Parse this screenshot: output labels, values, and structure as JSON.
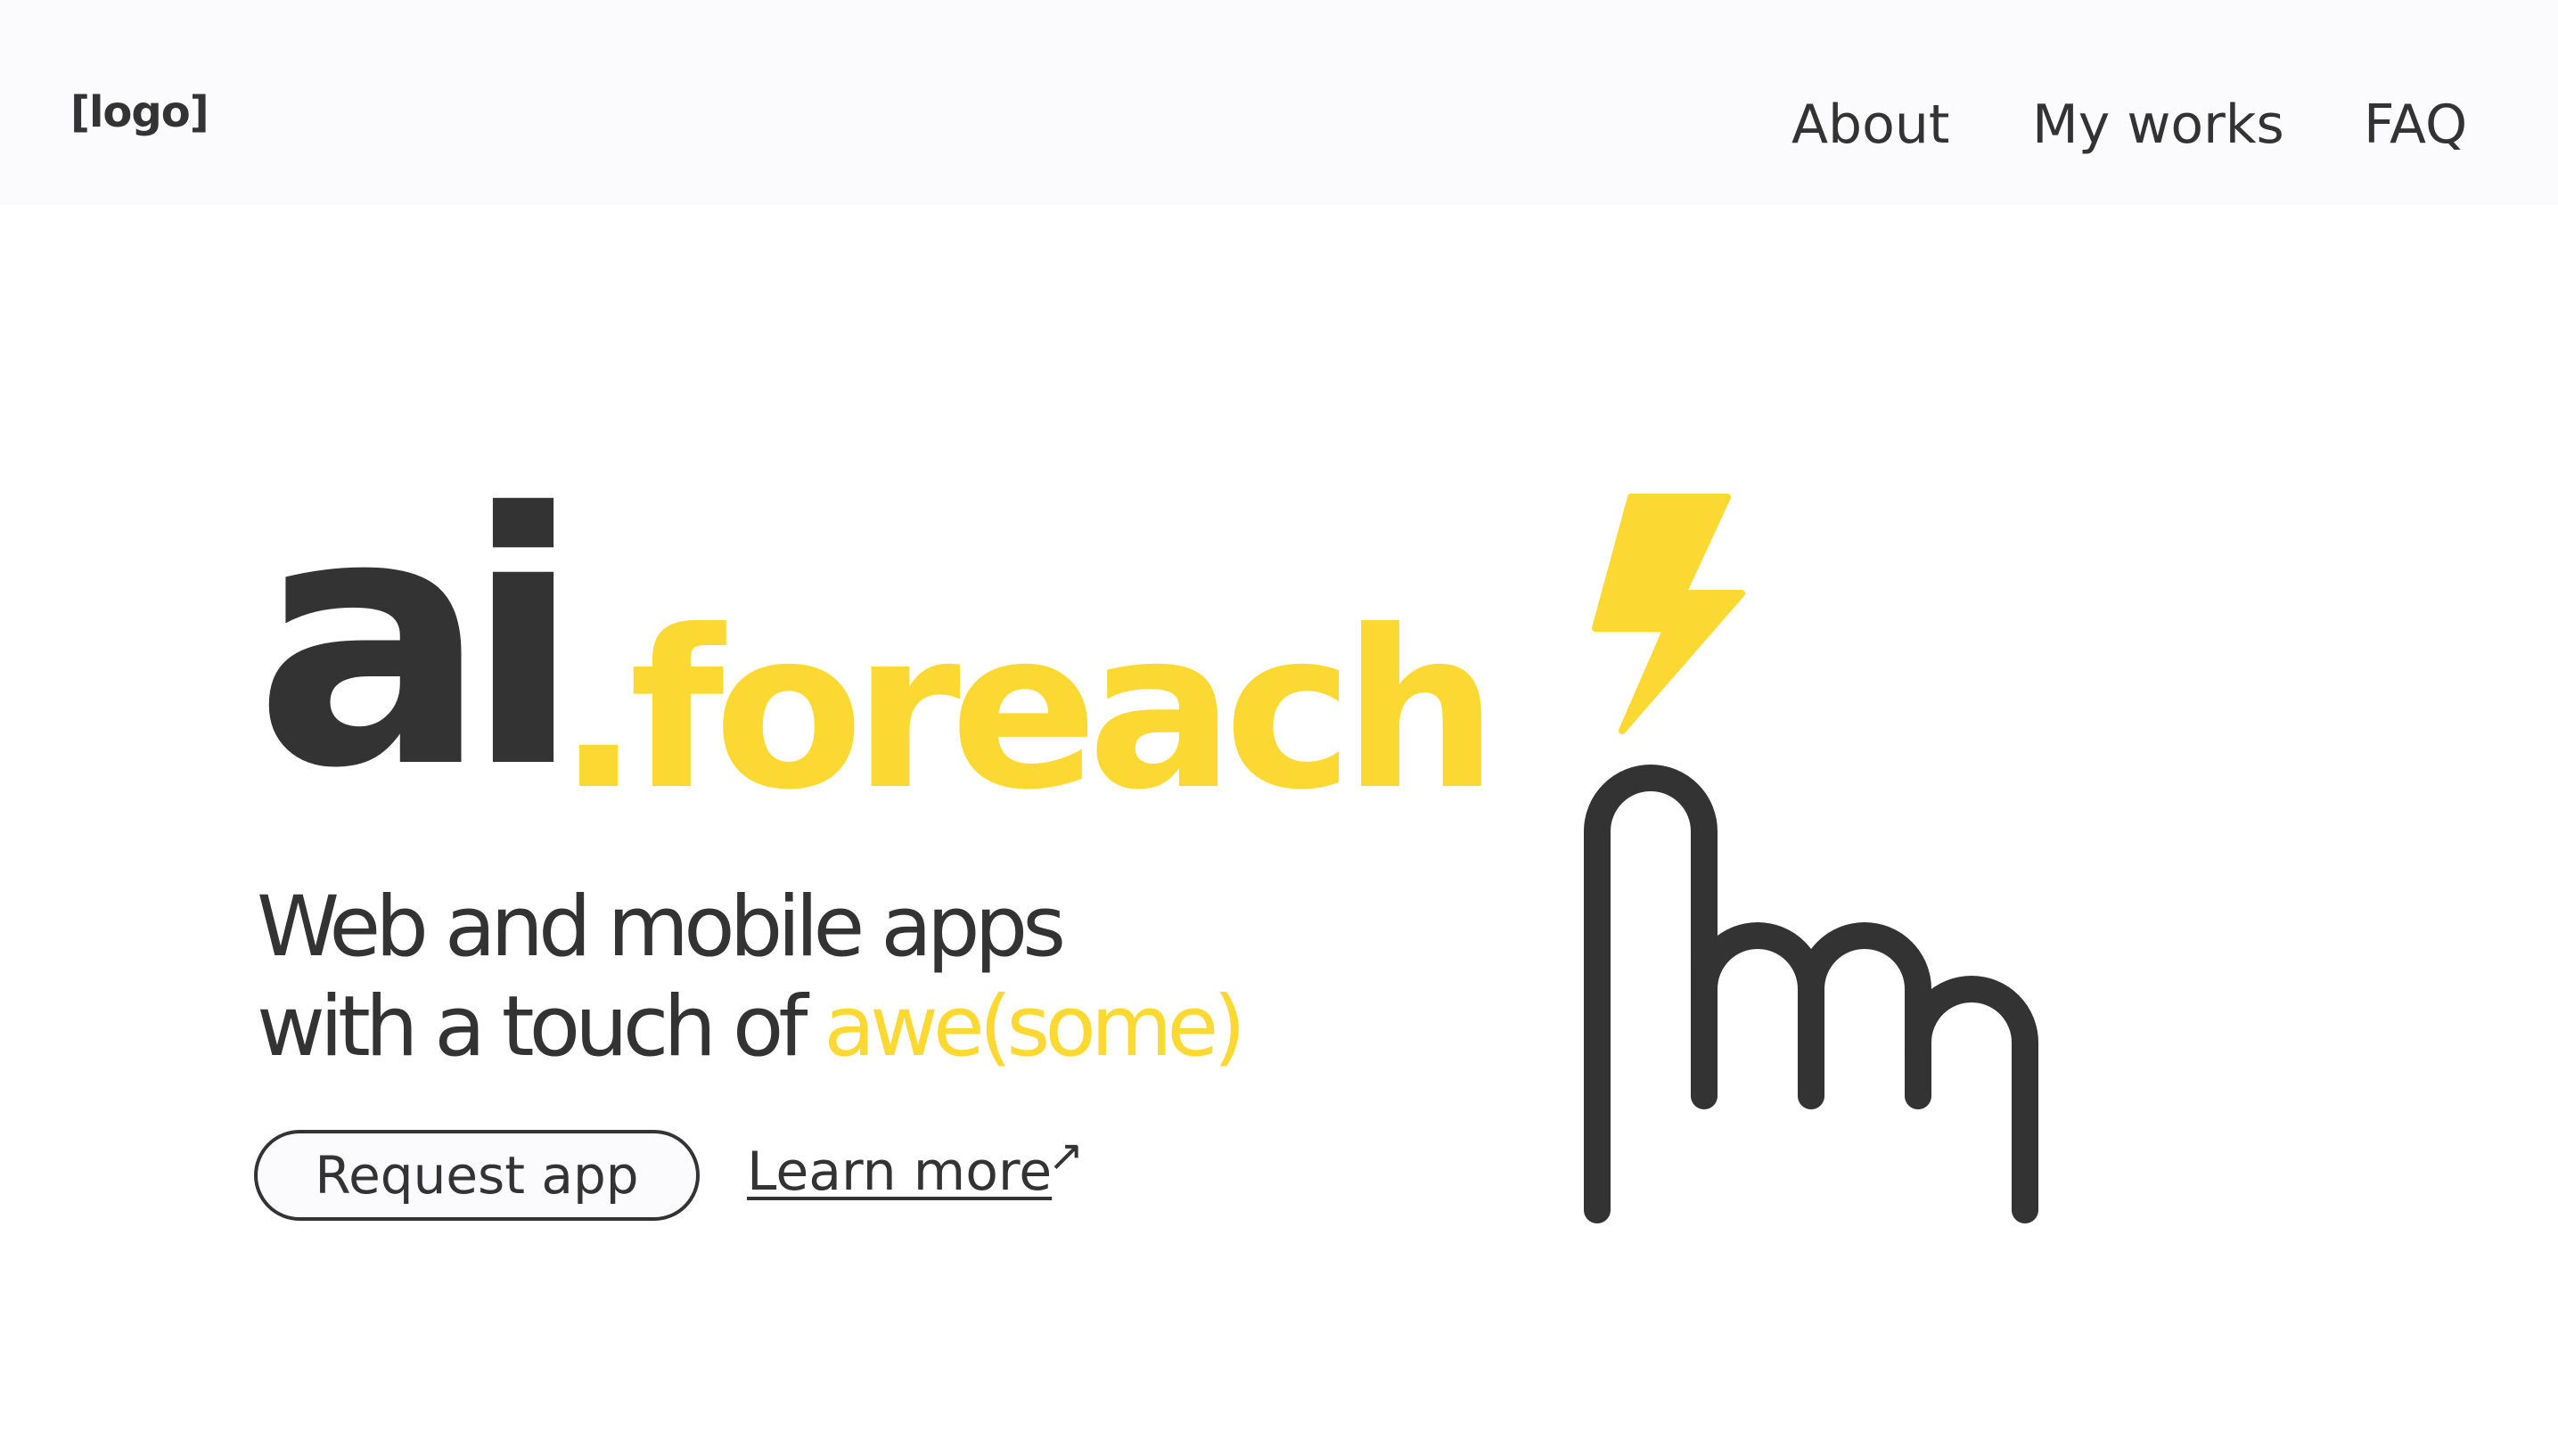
{
  "header": {
    "logo": "[logo]",
    "nav": [
      {
        "label": "About"
      },
      {
        "label": "My works"
      },
      {
        "label": "FAQ"
      }
    ]
  },
  "hero": {
    "brand_main": "ai",
    "brand_suffix": ".foreach",
    "tagline_line1": "Web and mobile apps",
    "tagline_line2_prefix": "with a touch of ",
    "tagline_line2_accent": "awe(some)",
    "primary_button": "Request app",
    "secondary_link": "Learn more",
    "secondary_link_icon": "arrow-up-right-icon"
  },
  "illustration": {
    "icons": [
      "lightning-bolt-icon",
      "pointing-hand-icon"
    ]
  },
  "colors": {
    "accent": "#fcd932",
    "text": "#333333",
    "header_background": "#fbfbfd",
    "background": "#ffffff"
  }
}
